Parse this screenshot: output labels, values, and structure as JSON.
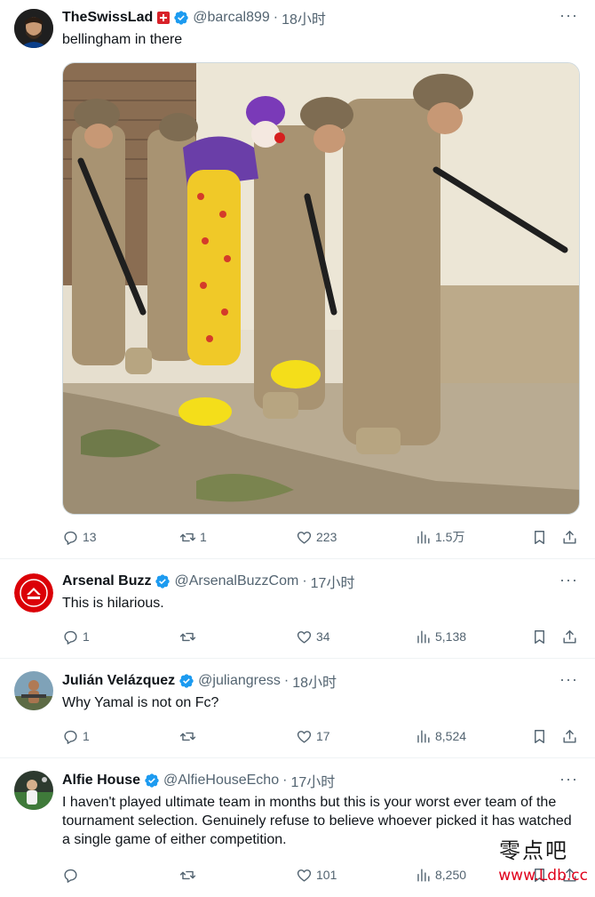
{
  "tweets": [
    {
      "name": "TheSwissLad",
      "handle": "@barcal899",
      "time": "18小时",
      "text": "bellingham in there",
      "stats": {
        "replies": "13",
        "retweets": "1",
        "likes": "223",
        "views": "1.5万"
      }
    },
    {
      "name": "Arsenal Buzz",
      "handle": "@ArsenalBuzzCom",
      "time": "17小时",
      "text": "This is hilarious.",
      "stats": {
        "replies": "1",
        "retweets": "",
        "likes": "34",
        "views": "5,138"
      }
    },
    {
      "name": "Julián Velázquez",
      "handle": "@juliangress",
      "time": "18小时",
      "text": "Why Yamal is not on Fc?",
      "stats": {
        "replies": "1",
        "retweets": "",
        "likes": "17",
        "views": "8,524"
      }
    },
    {
      "name": "Alfie House",
      "handle": "@AlfieHouseEcho",
      "time": "17小时",
      "text": "I haven't played ultimate team in months but this is your worst ever team of the tournament selection. Genuinely refuse to believe whoever picked it has watched a single game of either competition.",
      "stats": {
        "replies": "",
        "retweets": "",
        "likes": "101",
        "views": "8,250"
      }
    }
  ],
  "separator": "·",
  "more_label": "···",
  "watermark": {
    "line1": "零点吧",
    "line2": "www.Ldb.cc"
  },
  "colors": {
    "verified": "#1d9bf0",
    "secondary_text": "#536471",
    "arsenal_red": "#db0007",
    "watermark_red": "#e0001b"
  }
}
